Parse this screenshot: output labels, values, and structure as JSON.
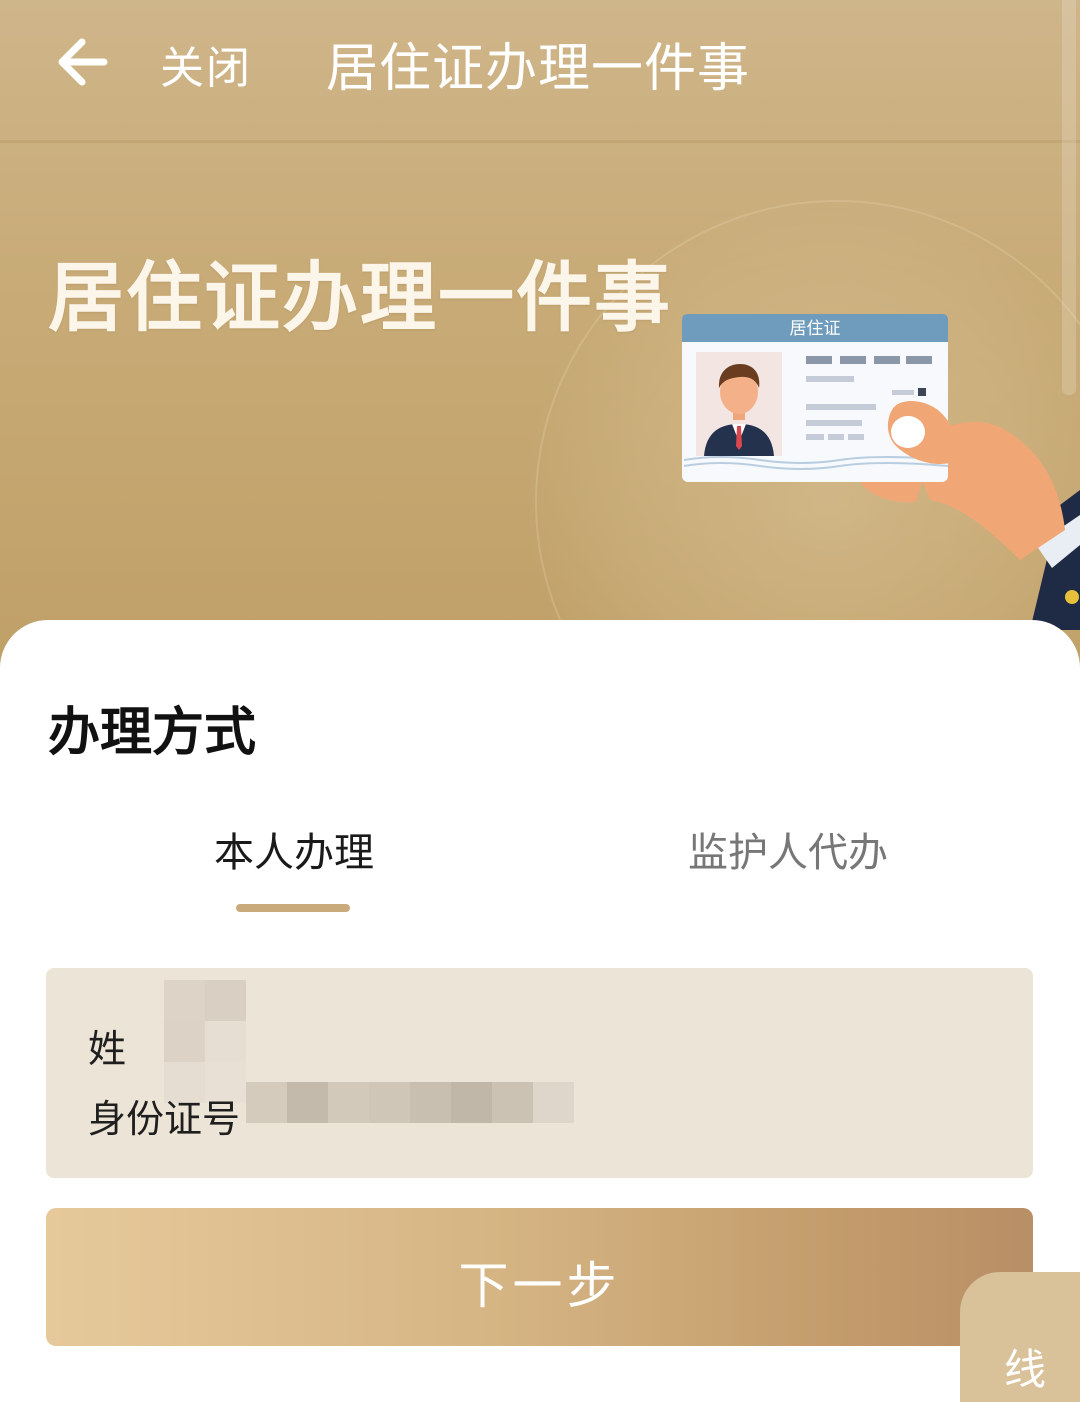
{
  "nav": {
    "close_label": "关闭",
    "title": "居住证办理一件事",
    "back_icon": "arrow-left-icon"
  },
  "hero": {
    "title": "居住证办理一件事",
    "card_label": "居住证"
  },
  "form": {
    "section_title": "办理方式",
    "tabs": [
      {
        "label": "本人办理",
        "active": true
      },
      {
        "label": "监护人代办",
        "active": false
      }
    ],
    "name_label": "姓名",
    "name_label_visible": "姓",
    "id_label": "身份证号",
    "next_label": "下一步"
  },
  "floating": {
    "label": "线"
  },
  "colors": {
    "accent": "#c9ab7b",
    "hero_bg": "#c8ab77",
    "info_bg": "#ece4d6"
  }
}
